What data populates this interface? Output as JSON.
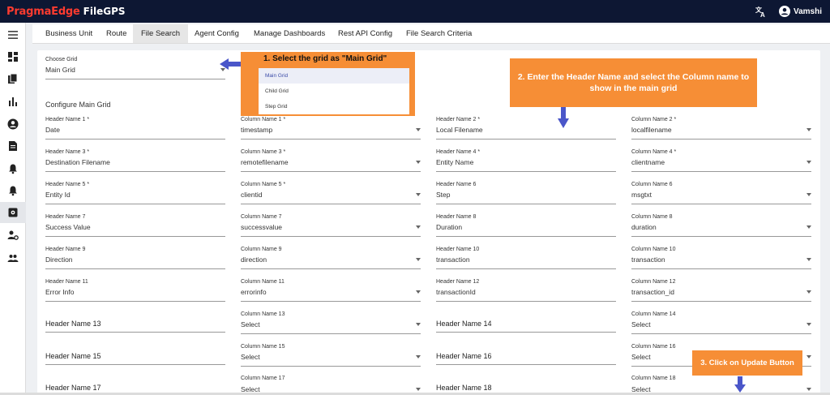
{
  "app": {
    "brand": "PragmaEdge",
    "product": "FileGPS",
    "user": "Vamshi"
  },
  "icons": {
    "translate": "translate-icon",
    "user": "account-circle-icon",
    "menu": "hamburger-menu-icon",
    "dashboard": "dashboard-icon",
    "files": "files-icon",
    "chart": "bar-chart-icon",
    "person": "person-icon",
    "document": "document-icon",
    "alert": "alert-bell-icon",
    "alert2": "alert-bell-icon",
    "settings": "settings-gear-icon",
    "admin": "user-settings-icon",
    "group": "group-icon"
  },
  "tabs": [
    "Business Unit",
    "Route",
    "File Search",
    "Agent Config",
    "Manage Dashboards",
    "Rest API Config",
    "File Search Criteria"
  ],
  "active_tab": "File Search",
  "choose_grid": {
    "label": "Choose Grid",
    "value": "Main Grid",
    "options": [
      "Main Grid",
      "Child Grid",
      "Step Grid"
    ]
  },
  "section_title": "Configure Main Grid",
  "fields": {
    "h1": {
      "label": "Header Name 1 *",
      "value": "Date"
    },
    "c1": {
      "label": "Column Name 1 *",
      "value": "timestamp"
    },
    "h2": {
      "label": "Header Name 2 *",
      "value": "Local Filename"
    },
    "c2": {
      "label": "Column Name 2 *",
      "value": "localfilename"
    },
    "h3": {
      "label": "Header Name 3 *",
      "value": "Destination Filename"
    },
    "c3": {
      "label": "Column Name 3 *",
      "value": "remotefilename"
    },
    "h4": {
      "label": "Header Name 4 *",
      "value": "Entity Name"
    },
    "c4": {
      "label": "Column Name 4 *",
      "value": "clientname"
    },
    "h5": {
      "label": "Header Name 5 *",
      "value": "Entity Id"
    },
    "c5": {
      "label": "Column Name 5 *",
      "value": "clientid"
    },
    "h6": {
      "label": "Header Name 6",
      "value": "Step"
    },
    "c6": {
      "label": "Column Name 6",
      "value": "msgtxt"
    },
    "h7": {
      "label": "Header Name 7",
      "value": "Success Value"
    },
    "c7": {
      "label": "Column Name 7",
      "value": "successvalue"
    },
    "h8": {
      "label": "Header Name 8",
      "value": "Duration"
    },
    "c8": {
      "label": "Column Name 8",
      "value": "duration"
    },
    "h9": {
      "label": "Header Name 9",
      "value": "Direction"
    },
    "c9": {
      "label": "Column Name 9",
      "value": "direction"
    },
    "h10": {
      "label": "Header Name 10",
      "value": "transaction"
    },
    "c10": {
      "label": "Column Name 10",
      "value": "transaction"
    },
    "h11": {
      "label": "Header Name 11",
      "value": "Error Info"
    },
    "c11": {
      "label": "Column Name 11",
      "value": "errorinfo"
    },
    "h12": {
      "label": "Header Name 12",
      "value": "transactionId"
    },
    "c12": {
      "label": "Column Name 12",
      "value": "transaction_id"
    },
    "h13": {
      "placeholder": "Header Name 13"
    },
    "c13": {
      "label": "Column Name 13",
      "value": "Select"
    },
    "h14": {
      "placeholder": "Header Name 14"
    },
    "c14": {
      "label": "Column Name 14",
      "value": "Select"
    },
    "h15": {
      "placeholder": "Header Name 15"
    },
    "c15": {
      "label": "Column Name 15",
      "value": "Select"
    },
    "h16": {
      "placeholder": "Header Name 16"
    },
    "c16": {
      "label": "Column Name 16",
      "value": "Select"
    },
    "h17": {
      "placeholder": "Header Name 17"
    },
    "c17": {
      "label": "Column Name 17",
      "value": "Select"
    },
    "h18": {
      "placeholder": "Header Name 18"
    },
    "c18": {
      "label": "Column Name 18",
      "value": "Select"
    }
  },
  "callouts": {
    "step1": "1. Select the grid as \"Main Grid\"",
    "step2": "2. Enter the Header Name and select the Column name to show in the main grid",
    "step3": "3. Click on Update Button"
  },
  "colors": {
    "topbar": "#0d1733",
    "brand_red": "#ff3b2f",
    "callout_orange": "#f68e36",
    "arrow_blue": "#4a56c9"
  }
}
